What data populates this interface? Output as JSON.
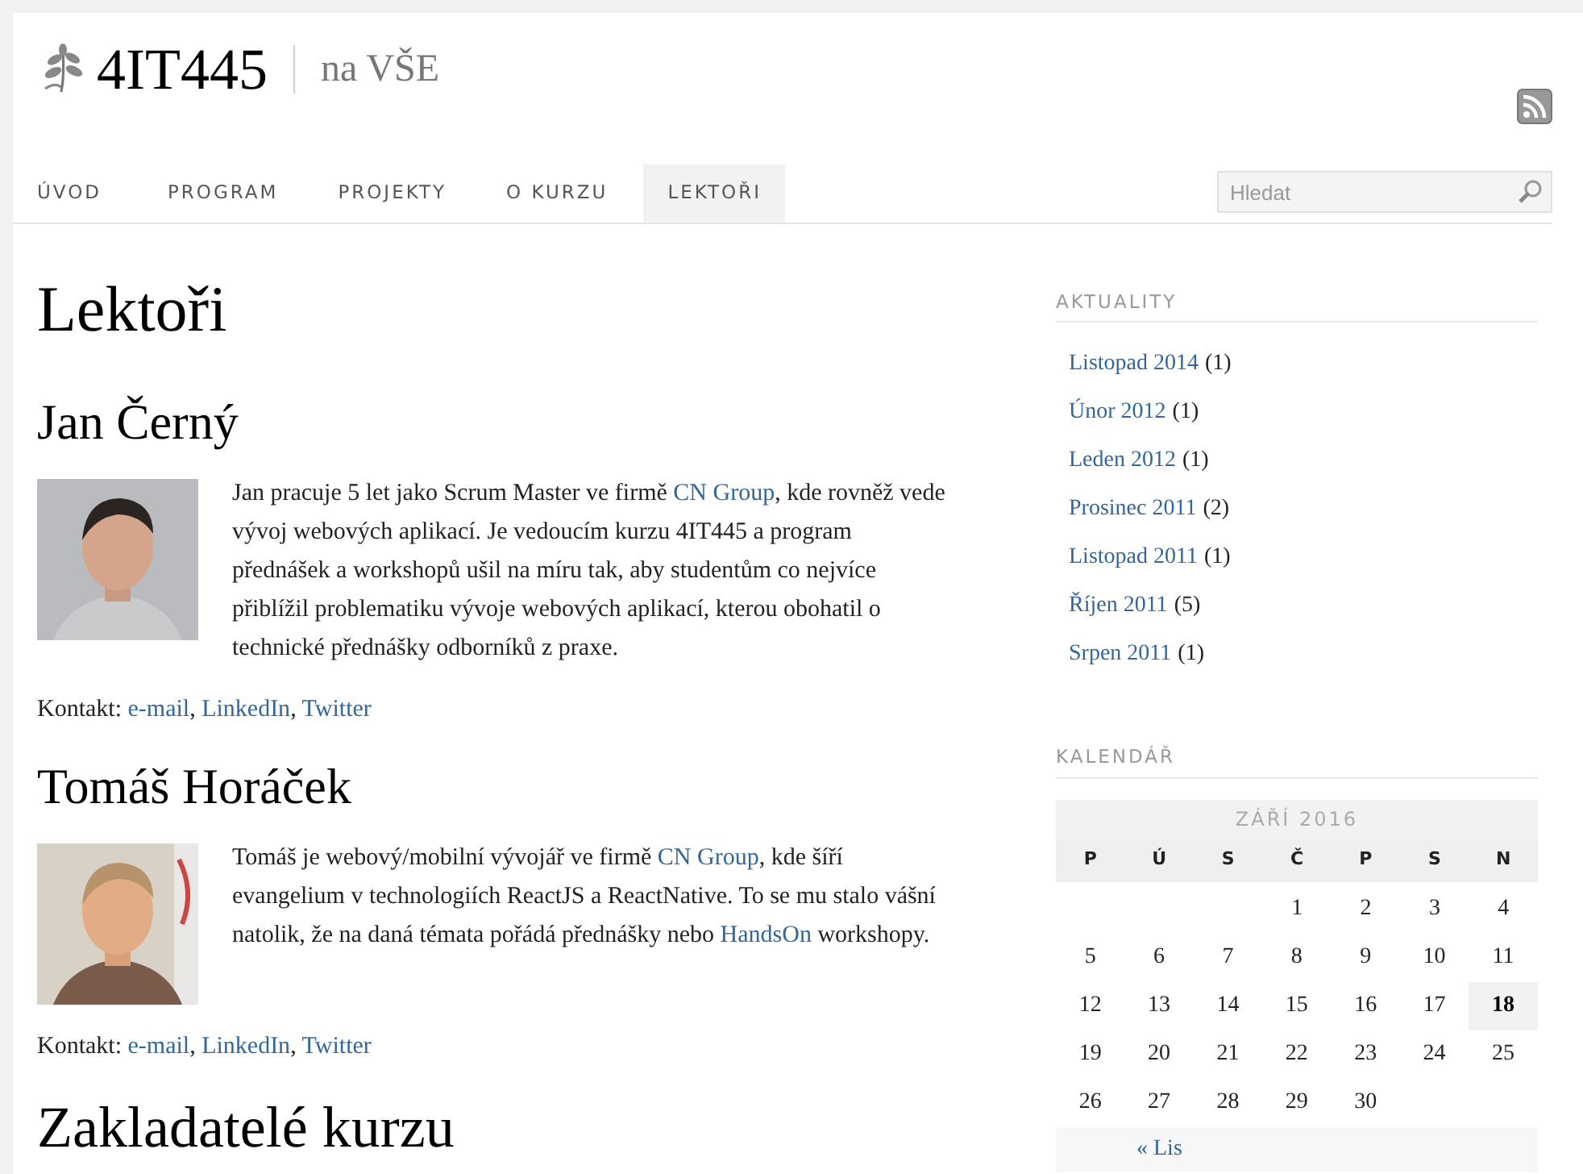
{
  "site": {
    "title": "4IT445",
    "subtitle": "na VŠE"
  },
  "nav": [
    {
      "label": "ÚVOD",
      "selected": false
    },
    {
      "label": "PROGRAM",
      "selected": false
    },
    {
      "label": "PROJEKTY",
      "selected": false
    },
    {
      "label": "O KURZU",
      "selected": false
    },
    {
      "label": "LEKTOŘI",
      "selected": true
    }
  ],
  "search": {
    "placeholder": "Hledat"
  },
  "page_title": "Lektoři",
  "lecturers": [
    {
      "name": "Jan Černý",
      "photo": {
        "kind": "picture"
      },
      "bio": [
        {
          "kind": "text",
          "text": "Jan pracuje 5 let jako Scrum Master ve firmě "
        },
        {
          "kind": "link",
          "text": "CN Group"
        },
        {
          "kind": "text",
          "text": ", kde rovněž vede vývoj webových aplikací. Je vedoucím kurzu 4IT445 a program přednášek a workshopů ušil na míru tak, aby studentům co nejvíce přiblížil problematiku vývoje webových aplikací, kterou obohatil o technické přednášky odborníků z praxe."
        }
      ],
      "contact": [
        {
          "kind": "text",
          "text": "Kontakt: "
        },
        {
          "kind": "link",
          "text": "e-mail"
        },
        {
          "kind": "text",
          "text": ", "
        },
        {
          "kind": "link",
          "text": "LinkedIn"
        },
        {
          "kind": "text",
          "text": ", "
        },
        {
          "kind": "link",
          "text": "Twitter"
        }
      ]
    },
    {
      "name": "Tomáš Horáček",
      "photo": {
        "kind": "picture"
      },
      "bio": [
        {
          "kind": "text",
          "text": "Tomáš je webový/mobilní vývojář ve firmě "
        },
        {
          "kind": "link",
          "text": "CN Group"
        },
        {
          "kind": "text",
          "text": ", kde šíří evangelium v technologiích ReactJS a ReactNative. To se mu stalo vášní natolik, že na daná témata pořádá přednášky nebo "
        },
        {
          "kind": "link",
          "text": "HandsOn"
        },
        {
          "kind": "text",
          "text": " workshopy."
        }
      ],
      "contact": [
        {
          "kind": "text",
          "text": "Kontakt: "
        },
        {
          "kind": "link",
          "text": "e-mail"
        },
        {
          "kind": "text",
          "text": ", "
        },
        {
          "kind": "link",
          "text": "LinkedIn"
        },
        {
          "kind": "text",
          "text": ", "
        },
        {
          "kind": "link",
          "text": "Twitter"
        }
      ]
    }
  ],
  "next_section_title": "Zakladatelé kurzu",
  "sidebar": {
    "news": {
      "title": "AKTUALITY",
      "items": [
        {
          "label": "Listopad 2014",
          "count": "(1)"
        },
        {
          "label": "Únor 2012",
          "count": "(1)"
        },
        {
          "label": "Leden 2012",
          "count": "(1)"
        },
        {
          "label": "Prosinec 2011",
          "count": "(2)"
        },
        {
          "label": "Listopad 2011",
          "count": "(1)"
        },
        {
          "label": "Říjen 2011",
          "count": "(5)"
        },
        {
          "label": "Srpen 2011",
          "count": "(1)"
        }
      ]
    },
    "calendar": {
      "title": "KALENDÁŘ",
      "month": "ZÁŘÍ 2016",
      "weekdays": [
        "P",
        "Ú",
        "S",
        "Č",
        "P",
        "S",
        "N"
      ],
      "weeks": [
        {
          "kind": "first",
          "days": [
            {
              "day": "1",
              "selected": false
            },
            {
              "day": "2",
              "selected": false
            },
            {
              "day": "3",
              "selected": false
            },
            {
              "day": "4",
              "selected": false
            }
          ]
        },
        {
          "kind": "regular",
          "days": [
            {
              "day": "5",
              "selected": false
            },
            {
              "day": "6",
              "selected": false
            },
            {
              "day": "7",
              "selected": false
            },
            {
              "day": "8",
              "selected": false
            },
            {
              "day": "9",
              "selected": false
            },
            {
              "day": "10",
              "selected": false
            },
            {
              "day": "11",
              "selected": false
            }
          ]
        },
        {
          "kind": "regular",
          "days": [
            {
              "day": "12",
              "selected": false
            },
            {
              "day": "13",
              "selected": false
            },
            {
              "day": "14",
              "selected": false
            },
            {
              "day": "15",
              "selected": false
            },
            {
              "day": "16",
              "selected": false
            },
            {
              "day": "17",
              "selected": false
            },
            {
              "day": "18",
              "selected": true
            }
          ]
        },
        {
          "kind": "regular",
          "days": [
            {
              "day": "19",
              "selected": false
            },
            {
              "day": "20",
              "selected": false
            },
            {
              "day": "21",
              "selected": false
            },
            {
              "day": "22",
              "selected": false
            },
            {
              "day": "23",
              "selected": false
            },
            {
              "day": "24",
              "selected": false
            },
            {
              "day": "25",
              "selected": false
            }
          ]
        },
        {
          "kind": "regular",
          "days": [
            {
              "day": "26",
              "selected": false
            },
            {
              "day": "27",
              "selected": false
            },
            {
              "day": "28",
              "selected": false
            },
            {
              "day": "29",
              "selected": false
            },
            {
              "day": "30",
              "selected": false
            }
          ]
        }
      ],
      "prev": "« Lis"
    }
  }
}
